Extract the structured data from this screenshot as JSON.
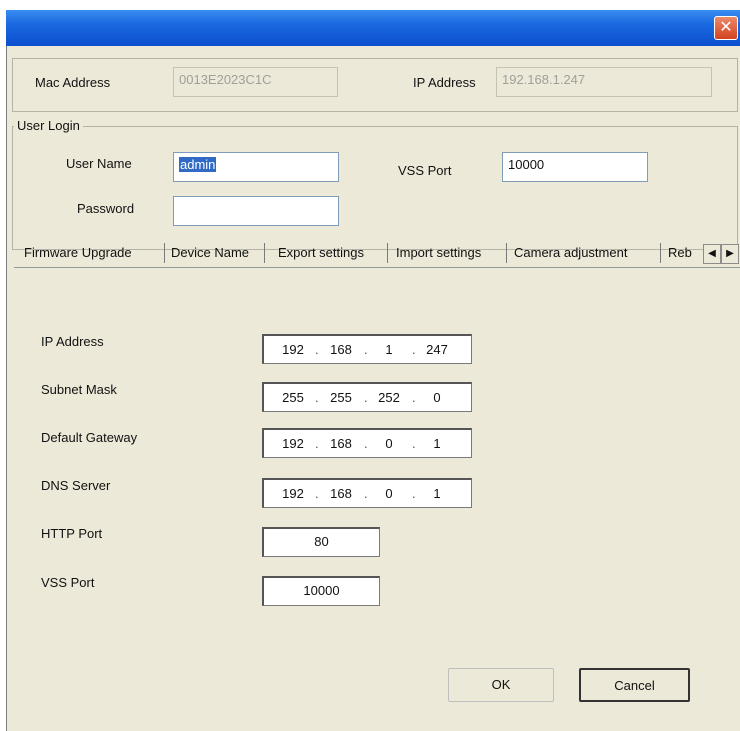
{
  "window": {
    "close_glyph": "✕"
  },
  "device": {
    "mac_label": "Mac Address",
    "mac_value": "0013E2023C1C",
    "ip_label": "IP Address",
    "ip_value": "192.168.1.247"
  },
  "login": {
    "group_label": "User Login",
    "username_label": "User Name",
    "username_value": "admin",
    "password_label": "Password",
    "password_value": "",
    "vss_label": "VSS Port",
    "vss_value": "10000"
  },
  "tabs": [
    {
      "label": "Firmware Upgrade"
    },
    {
      "label": "Device Name"
    },
    {
      "label": "Export settings"
    },
    {
      "label": "Import settings"
    },
    {
      "label": "Camera adjustment"
    },
    {
      "label": "Reb"
    }
  ],
  "tab_scroll": {
    "left_glyph": "◀",
    "right_glyph": "▶"
  },
  "network": {
    "ip_label": "IP Address",
    "ip": [
      "192",
      "168",
      "1",
      "247"
    ],
    "subnet_label": "Subnet Mask",
    "subnet": [
      "255",
      "255",
      "252",
      "0"
    ],
    "gateway_label": "Default Gateway",
    "gateway": [
      "192",
      "168",
      "0",
      "1"
    ],
    "dns_label": "DNS Server",
    "dns": [
      "192",
      "168",
      "0",
      "1"
    ],
    "http_label": "HTTP Port",
    "http_value": "80",
    "vss_label": "VSS Port",
    "vss_value": "10000",
    "dot": "."
  },
  "buttons": {
    "ok": "OK",
    "cancel": "Cancel"
  }
}
